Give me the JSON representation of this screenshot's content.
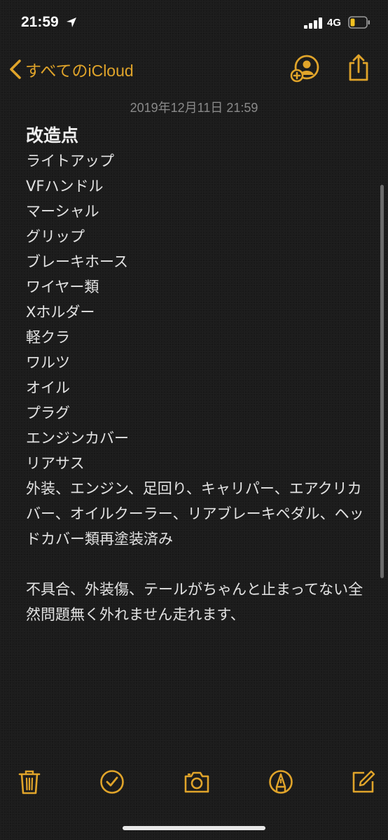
{
  "status": {
    "time": "21:59",
    "network": "4G"
  },
  "nav": {
    "back_label": "すべてのiCloud"
  },
  "note": {
    "timestamp": "2019年12月11日 21:59",
    "title": "改造点",
    "lines": [
      "ライトアップ",
      "VFハンドル",
      "マーシャル",
      "グリップ",
      "ブレーキホース",
      "ワイヤー類",
      "Xホルダー",
      "軽クラ",
      "ワルツ",
      "オイル",
      "プラグ",
      "エンジンカバー",
      "リアサス"
    ],
    "paragraph1": "外装、エンジン、足回り、キャリパー、エアクリカバー、オイルクーラー、リアブレーキペダル、ヘッドカバー類再塗装済み",
    "paragraph2": "不具合、外装傷、テールがちゃんと止まってない全然問題無く外れません走れます、"
  },
  "colors": {
    "accent": "#e0a42a",
    "background": "#1c1c1c",
    "text": "#e3e3e3",
    "timestamp": "#8a8a8a"
  },
  "icons": {
    "location": "location-arrow-icon",
    "signal": "cellular-signal-icon",
    "battery": "battery-low-icon",
    "back": "chevron-left-icon",
    "share_person": "add-person-icon",
    "share": "share-icon",
    "trash": "trash-icon",
    "checklist": "checkmark-circle-icon",
    "camera": "camera-icon",
    "markup": "pen-tip-icon",
    "compose": "compose-icon"
  }
}
